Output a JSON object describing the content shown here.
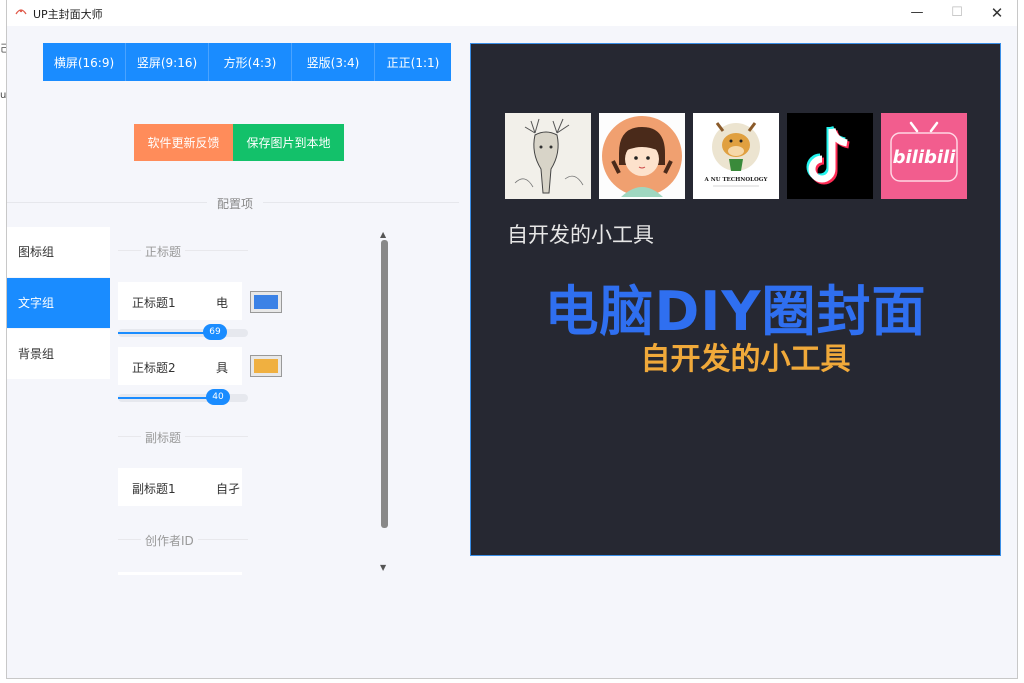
{
  "window": {
    "title": "UP主封面大师",
    "minimize": "—",
    "maximize": "☐",
    "close": "✕"
  },
  "ratios": [
    "横屏(16:9)",
    "竖屏(9:16)",
    "方形(4:3)",
    "竖版(3:4)",
    "正正(1:1)"
  ],
  "actions": {
    "feedback": "软件更新反馈",
    "save": "保存图片到本地"
  },
  "config": {
    "section_label": "配置项"
  },
  "sidebar": {
    "tabs": [
      "图标组",
      "文字组",
      "背景组"
    ],
    "active_index": 1
  },
  "text_groups": {
    "main_title_label": "正标题",
    "main_title_1": {
      "label": "正标题1",
      "value": "电",
      "color": "#3b82e6",
      "slider": 69
    },
    "main_title_2": {
      "label": "正标题2",
      "value": "具",
      "color": "#f0b040",
      "slider": 40
    },
    "subtitle_label": "副标题",
    "subtitle_1": {
      "label": "副标题1",
      "value": "自孑"
    },
    "creator_label": "创作者ID"
  },
  "preview": {
    "subtitle": "自开发的小工具",
    "title": "电脑DIY圈封面",
    "tagline": "自开发的小工具",
    "title_color": "#2f6ff0",
    "tagline_color": "#f0a93a",
    "icons": [
      "deer-sketch-icon",
      "girl-avatar-icon",
      "cow-mascot-icon",
      "tiktok-icon",
      "bilibili-icon"
    ],
    "cow_caption": "A NU TECHNOLOGY",
    "bilibili_text": "bilibili"
  },
  "edge": {
    "glyph_top": "己",
    "glyph_mid": "u"
  }
}
